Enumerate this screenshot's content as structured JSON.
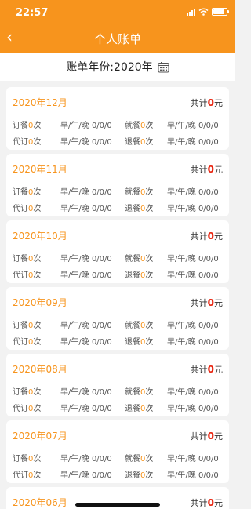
{
  "status_bar": {
    "time": "22:57",
    "battery_level": 0.9
  },
  "nav": {
    "back_icon": "‹",
    "title": "个人账单"
  },
  "year_selector": {
    "label": "账单年份:",
    "year": "2020年"
  },
  "colors": {
    "accent": "#f7941d",
    "amount": "#e8210c"
  },
  "cards": [
    {
      "month": "2020年12月",
      "total_label": "共计",
      "total_value": "0",
      "total_unit": "元",
      "order_label": "订餐",
      "order_count": "0",
      "order_unit": "次",
      "order_meal_label": "早/午/晚",
      "order_meal_values": "0/0/0",
      "dine_label": "就餐",
      "dine_count": "0",
      "dine_unit": "次",
      "dine_meal_label": "早/午/晚",
      "dine_meal_values": "0/0/0",
      "proxy_label": "代订",
      "proxy_count": "0",
      "proxy_unit": "次",
      "proxy_meal_label": "早/午/晚",
      "proxy_meal_values": "0/0/0",
      "refund_label": "退餐",
      "refund_count": "0",
      "refund_unit": "次",
      "refund_meal_label": "早/午/晚",
      "refund_meal_values": "0/0/0"
    },
    {
      "month": "2020年11月",
      "total_label": "共计",
      "total_value": "0",
      "total_unit": "元",
      "order_label": "订餐",
      "order_count": "0",
      "order_unit": "次",
      "order_meal_label": "早/午/晚",
      "order_meal_values": "0/0/0",
      "dine_label": "就餐",
      "dine_count": "0",
      "dine_unit": "次",
      "dine_meal_label": "早/午/晚",
      "dine_meal_values": "0/0/0",
      "proxy_label": "代订",
      "proxy_count": "0",
      "proxy_unit": "次",
      "proxy_meal_label": "早/午/晚",
      "proxy_meal_values": "0/0/0",
      "refund_label": "退餐",
      "refund_count": "0",
      "refund_unit": "次",
      "refund_meal_label": "早/午/晚",
      "refund_meal_values": "0/0/0"
    },
    {
      "month": "2020年10月",
      "total_label": "共计",
      "total_value": "0",
      "total_unit": "元",
      "order_label": "订餐",
      "order_count": "0",
      "order_unit": "次",
      "order_meal_label": "早/午/晚",
      "order_meal_values": "0/0/0",
      "dine_label": "就餐",
      "dine_count": "0",
      "dine_unit": "次",
      "dine_meal_label": "早/午/晚",
      "dine_meal_values": "0/0/0",
      "proxy_label": "代订",
      "proxy_count": "0",
      "proxy_unit": "次",
      "proxy_meal_label": "早/午/晚",
      "proxy_meal_values": "0/0/0",
      "refund_label": "退餐",
      "refund_count": "0",
      "refund_unit": "次",
      "refund_meal_label": "早/午/晚",
      "refund_meal_values": "0/0/0"
    },
    {
      "month": "2020年09月",
      "total_label": "共计",
      "total_value": "0",
      "total_unit": "元",
      "order_label": "订餐",
      "order_count": "0",
      "order_unit": "次",
      "order_meal_label": "早/午/晚",
      "order_meal_values": "0/0/0",
      "dine_label": "就餐",
      "dine_count": "0",
      "dine_unit": "次",
      "dine_meal_label": "早/午/晚",
      "dine_meal_values": "0/0/0",
      "proxy_label": "代订",
      "proxy_count": "0",
      "proxy_unit": "次",
      "proxy_meal_label": "早/午/晚",
      "proxy_meal_values": "0/0/0",
      "refund_label": "退餐",
      "refund_count": "0",
      "refund_unit": "次",
      "refund_meal_label": "早/午/晚",
      "refund_meal_values": "0/0/0"
    },
    {
      "month": "2020年08月",
      "total_label": "共计",
      "total_value": "0",
      "total_unit": "元",
      "order_label": "订餐",
      "order_count": "0",
      "order_unit": "次",
      "order_meal_label": "早/午/晚",
      "order_meal_values": "0/0/0",
      "dine_label": "就餐",
      "dine_count": "0",
      "dine_unit": "次",
      "dine_meal_label": "早/午/晚",
      "dine_meal_values": "0/0/0",
      "proxy_label": "代订",
      "proxy_count": "0",
      "proxy_unit": "次",
      "proxy_meal_label": "早/午/晚",
      "proxy_meal_values": "0/0/0",
      "refund_label": "退餐",
      "refund_count": "0",
      "refund_unit": "次",
      "refund_meal_label": "早/午/晚",
      "refund_meal_values": "0/0/0"
    },
    {
      "month": "2020年07月",
      "total_label": "共计",
      "total_value": "0",
      "total_unit": "元",
      "order_label": "订餐",
      "order_count": "0",
      "order_unit": "次",
      "order_meal_label": "早/午/晚",
      "order_meal_values": "0/0/0",
      "dine_label": "就餐",
      "dine_count": "0",
      "dine_unit": "次",
      "dine_meal_label": "早/午/晚",
      "dine_meal_values": "0/0/0",
      "proxy_label": "代订",
      "proxy_count": "0",
      "proxy_unit": "次",
      "proxy_meal_label": "早/午/晚",
      "proxy_meal_values": "0/0/0",
      "refund_label": "退餐",
      "refund_count": "0",
      "refund_unit": "次",
      "refund_meal_label": "早/午/晚",
      "refund_meal_values": "0/0/0"
    },
    {
      "month": "2020年06月",
      "total_label": "共计",
      "total_value": "0",
      "total_unit": "元"
    }
  ]
}
